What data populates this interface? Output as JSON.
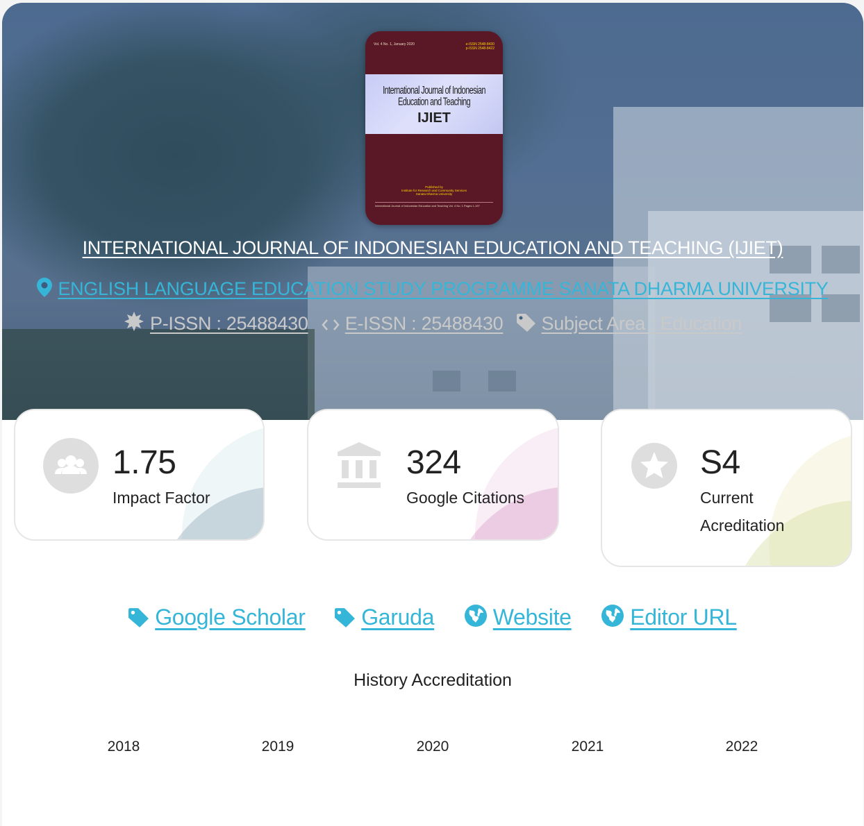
{
  "journal": {
    "title": "INTERNATIONAL JOURNAL OF INDONESIAN EDUCATION AND TEACHING (IJIET)",
    "institution": "ENGLISH LANGUAGE EDUCATION STUDY PROGRAMME SANATA DHARMA UNIVERSITY",
    "p_issn": "P-ISSN : 25488430",
    "e_issn": "E-ISSN : 25488430",
    "subject_area": "Subject Area : Education"
  },
  "cover": {
    "volume_line": "Vol. 4 No. 1, January 2020",
    "issn_lines": [
      "e-ISSN 2548-8430",
      "p-ISSN 2548-8422"
    ],
    "band_title": "International Journal of Indonesian Education and Teaching",
    "band_abbr": "IJIET",
    "publisher_lines": [
      "Published by",
      "Institute for Research and Community Services",
      "Sanata Dharma University"
    ],
    "footer_text": "International Journal of Indonesian Education and Teaching   Vol. 4  No. 1   Pages 1-197"
  },
  "stats": {
    "impact": {
      "value": "1.75",
      "label": "Impact Factor",
      "icon": "users-icon",
      "accent": "#7f99ab"
    },
    "citations": {
      "value": "324",
      "label": "Google Citations",
      "icon": "bank-icon",
      "accent": "#d58fc0"
    },
    "accreditation": {
      "value": "S4",
      "label_line1": "Current",
      "label_line2": "Acreditation",
      "icon": "star-icon",
      "accent": "#d7dfa6"
    }
  },
  "links": {
    "google_scholar": "Google Scholar",
    "garuda": "Garuda",
    "website": "Website",
    "editor_url": "Editor URL"
  },
  "history": {
    "title": "History Accreditation",
    "years": [
      "2018",
      "2019",
      "2020",
      "2021",
      "2022"
    ]
  },
  "colors": {
    "link": "#35b6d8",
    "meta": "#c9c9c9",
    "hero_overlay": "#304e76"
  }
}
